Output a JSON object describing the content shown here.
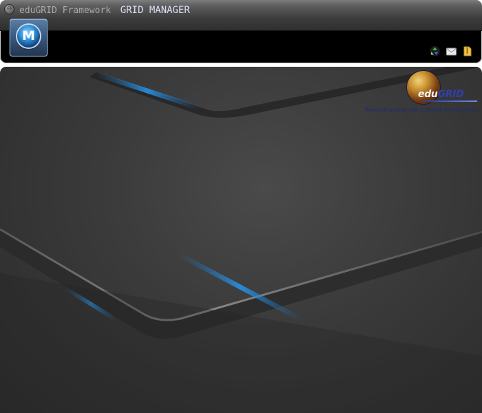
{
  "header": {
    "app_name": "eduGRID Framework",
    "section_title": "GRID MANAGER",
    "title_control_glyph": "⊖",
    "menu_button": {
      "label": "M",
      "icon": "menu-orb-icon"
    },
    "tray_icons": [
      "recycle-icon",
      "mail-icon",
      "folder-icon"
    ]
  },
  "branding": {
    "logo_word_edu": "edu",
    "logo_word_grid": "GRID",
    "tagline": "Revolutionizing the concept of education"
  },
  "colors": {
    "accent_blue": "#2f8fd8",
    "title_text": "#d9e0f3",
    "desktop_bg": "#3a3a3a"
  }
}
